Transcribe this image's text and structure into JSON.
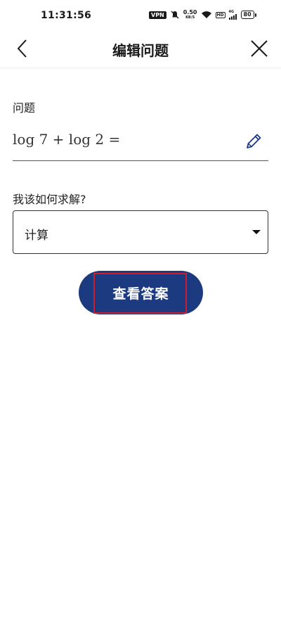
{
  "status_bar": {
    "time": "11:31:56",
    "vpn": "VPN",
    "speed_value": "0.50",
    "speed_unit": "KB/S",
    "network": "4G",
    "hd": "HD",
    "battery": "80"
  },
  "header": {
    "title": "编辑问题",
    "back_icon": "chevron-left-icon",
    "close_icon": "close-icon"
  },
  "question": {
    "label": "问题",
    "value": "log 7 + log 2 =",
    "edit_icon": "pencil-icon"
  },
  "method": {
    "label": "我该如何求解?",
    "selected": "计算"
  },
  "actions": {
    "show_answer": "查看答案"
  },
  "colors": {
    "primary": "#1c3a80",
    "highlight": "#d01c2a",
    "icon_blue": "#1c3a80"
  }
}
